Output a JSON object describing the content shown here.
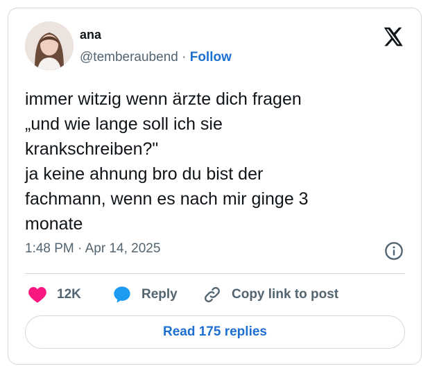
{
  "author": {
    "name": "ana",
    "handle": "@temberaubend",
    "separator": "·",
    "follow_label": "Follow"
  },
  "tweet": {
    "text": "immer witzig wenn ärzte dich fragen\n„und wie lange soll ich sie\nkrankschreiben?\"\nja keine ahnung bro du bist der\nfachmann, wenn es nach mir ginge 3\nmonate",
    "timestamp": "1:48 PM · Apr 14, 2025"
  },
  "actions": {
    "like_count": "12K",
    "reply_label": "Reply",
    "copy_link_label": "Copy link to post"
  },
  "read_replies_label": "Read 175 replies",
  "icons": [
    "x-logo-icon",
    "info-icon",
    "heart-icon",
    "reply-bubble-icon",
    "link-icon"
  ],
  "colors": {
    "accent": "#1d6fd1",
    "like": "#f91880",
    "reply": "#1d9bf0",
    "secondary_text": "#536471",
    "border": "#cfd9de"
  }
}
